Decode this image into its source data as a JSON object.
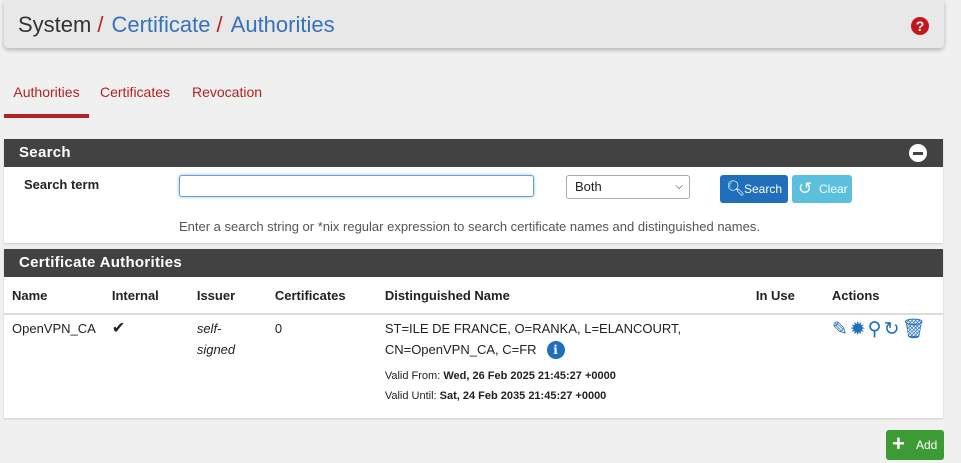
{
  "breadcrumb": {
    "root": "System",
    "sep": "/",
    "crumb1": "Certificate",
    "crumb2": "Authorities"
  },
  "help_icon": "question-circle-icon",
  "tabs": [
    {
      "label": "Authorities",
      "active": true
    },
    {
      "label": "Certificates",
      "active": false
    },
    {
      "label": "Revocation",
      "active": false
    }
  ],
  "search_panel": {
    "title": "Search",
    "label": "Search term",
    "input_value": "",
    "select_value": "Both",
    "search_button": "Search",
    "clear_button": "Clear",
    "help": "Enter a search string or *nix regular expression to search certificate names and distinguished names."
  },
  "ca_panel": {
    "title": "Certificate Authorities",
    "columns": [
      "Name",
      "Internal",
      "Issuer",
      "Certificates",
      "Distinguished Name",
      "In Use",
      "Actions"
    ],
    "rows": [
      {
        "name": "OpenVPN_CA",
        "internal": "✔",
        "issuer_line1": "self-",
        "issuer_line2": "signed",
        "certificates": "0",
        "dn_line1": "ST=ILE DE FRANCE, O=RANKA, L=ELANCOURT,",
        "dn_line2": "CN=OpenVPN_CA, C=FR",
        "valid_from_label": "Valid From:",
        "valid_from": "Wed, 26 Feb 2025 21:45:27 +0000",
        "valid_until_label": "Valid Until:",
        "valid_until": "Sat, 24 Feb 2035 21:45:27 +0000",
        "in_use": ""
      }
    ]
  },
  "add_button": "Add",
  "colors": {
    "accent_red": "#b22222",
    "primary": "#1f6fbb",
    "success": "#3d9b35",
    "panel_head": "#424242"
  }
}
